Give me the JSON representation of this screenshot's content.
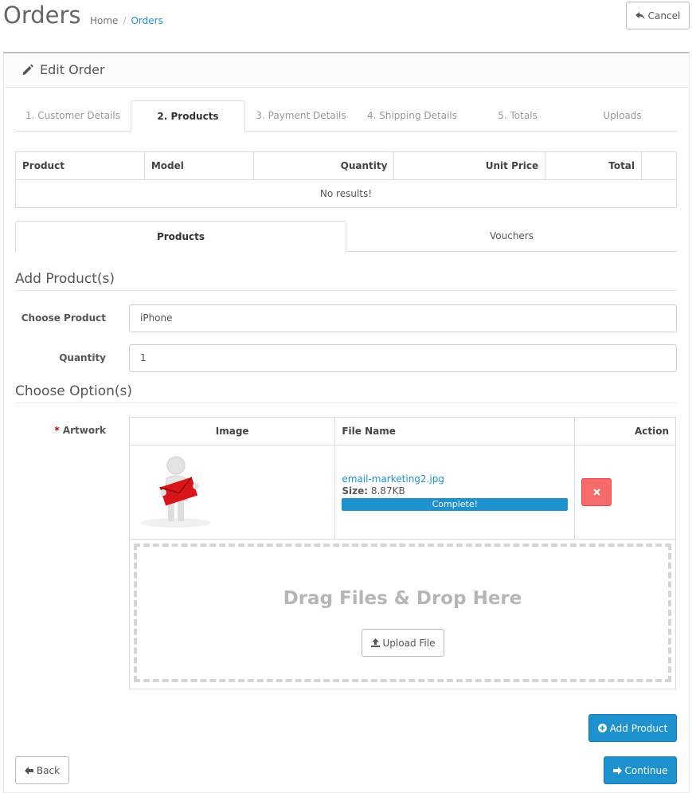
{
  "header": {
    "title": "Orders",
    "breadcrumb": {
      "home": "Home",
      "current": "Orders"
    },
    "cancel_label": "Cancel"
  },
  "panel": {
    "title": "Edit Order"
  },
  "tabs": [
    {
      "label": "1. Customer Details"
    },
    {
      "label": "2. Products"
    },
    {
      "label": "3. Payment Details"
    },
    {
      "label": "4. Shipping Details"
    },
    {
      "label": "5. Totals"
    },
    {
      "label": "Uploads"
    }
  ],
  "products_table": {
    "headers": [
      "Product",
      "Model",
      "Quantity",
      "Unit Price",
      "Total"
    ],
    "empty_text": "No results!"
  },
  "subtabs": [
    {
      "label": "Products"
    },
    {
      "label": "Vouchers"
    }
  ],
  "add_product": {
    "legend": "Add Product(s)",
    "choose_product_label": "Choose Product",
    "choose_product_value": "iPhone",
    "quantity_label": "Quantity",
    "quantity_value": "1"
  },
  "options": {
    "legend": "Choose Option(s)",
    "artwork_label": "Artwork",
    "required_mark": "*",
    "table_headers": {
      "image": "Image",
      "file_name": "File Name",
      "action": "Action"
    },
    "file": {
      "name": "email-marketing2.jpg",
      "size_label": "Size:",
      "size_value": "8.87KB",
      "status": "Complete!",
      "progress": 1.0
    },
    "drop_text": "Drag Files & Drop Here",
    "upload_label": "Upload File"
  },
  "buttons": {
    "add_product": "Add Product",
    "back": "Back",
    "continue": "Continue"
  },
  "colors": {
    "primary": "#1e91cf",
    "danger": "#f56b6b",
    "required": "#cc0000"
  }
}
